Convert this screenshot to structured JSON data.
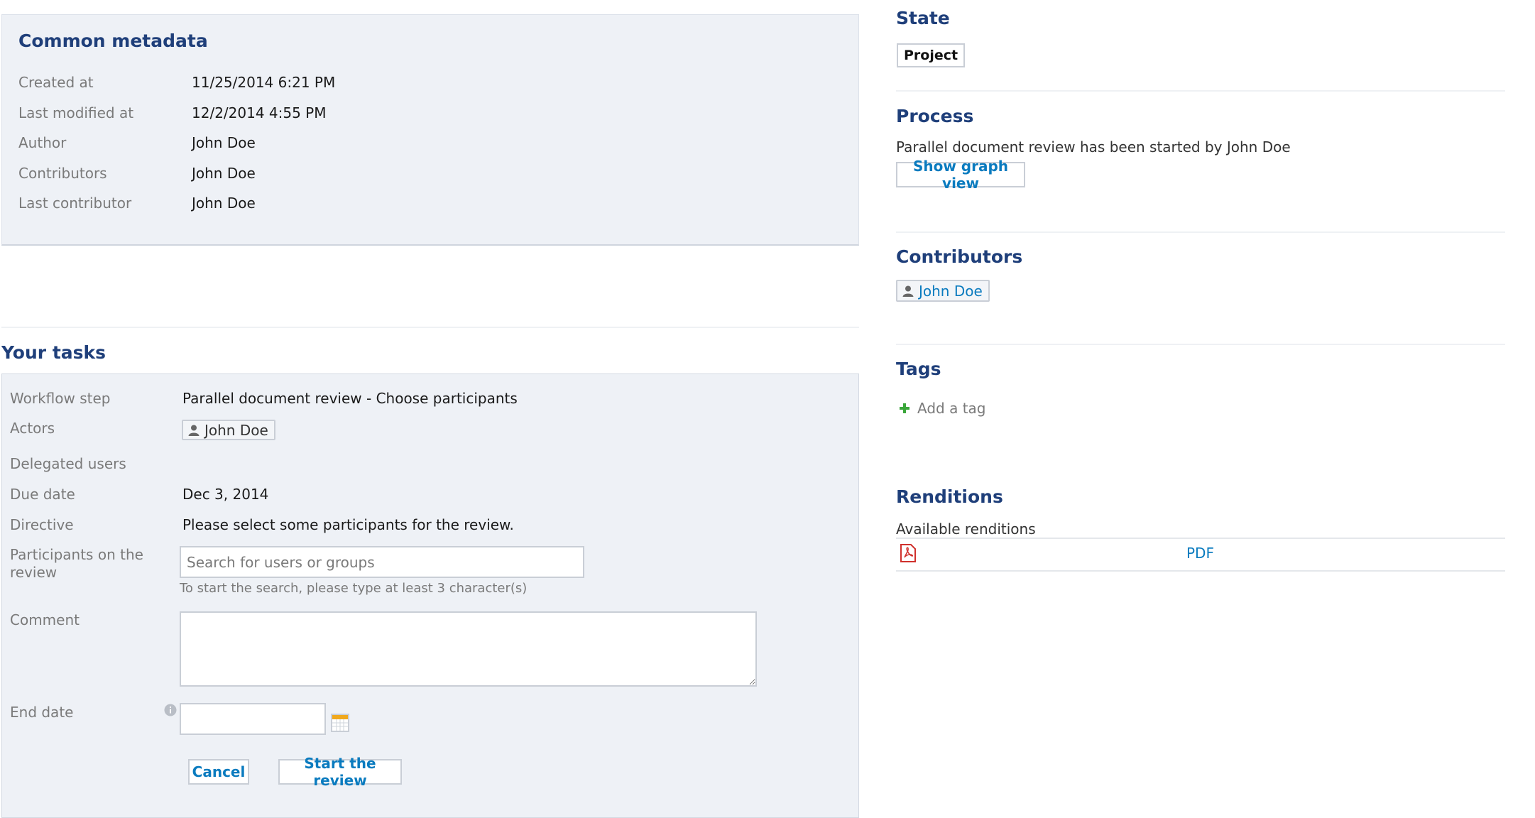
{
  "common_metadata": {
    "title": "Common metadata",
    "rows": [
      {
        "label": "Created at",
        "value": "11/25/2014 6:21 PM"
      },
      {
        "label": "Last modified at",
        "value": "12/2/2014 4:55 PM"
      },
      {
        "label": "Author",
        "value": "John Doe"
      },
      {
        "label": "Contributors",
        "value": "John Doe"
      },
      {
        "label": "Last contributor",
        "value": "John Doe"
      }
    ]
  },
  "tasks": {
    "title": "Your tasks",
    "workflow_step_label": "Workflow step",
    "workflow_step_value": "Parallel document review - Choose participants",
    "actors_label": "Actors",
    "actors_value": "John Doe",
    "delegated_label": "Delegated users",
    "due_date_label": "Due date",
    "due_date_value": "Dec 3, 2014",
    "directive_label": "Directive",
    "directive_value": "Please select some participants for the review.",
    "participants_label": "Participants on the review",
    "participants_placeholder": "Search for users or groups",
    "participants_hint": "To start the search, please type at least 3 character(s)",
    "comment_label": "Comment",
    "comment_value": "",
    "end_date_label": "End date",
    "end_date_value": "",
    "cancel_label": "Cancel",
    "start_label": "Start the review"
  },
  "sidebar": {
    "state_title": "State",
    "state_value": "Project",
    "process_title": "Process",
    "process_text": "Parallel document review has been started by John Doe",
    "graph_button": "Show graph view",
    "contributors_title": "Contributors",
    "contributor_name": "John Doe",
    "tags_title": "Tags",
    "add_tag_label": "Add a tag",
    "renditions_title": "Renditions",
    "available_label": "Available renditions",
    "rendition_name": "PDF"
  },
  "colors": {
    "heading": "#1f3f7a",
    "link": "#0a7bbf",
    "panel_bg": "#eef1f6",
    "add_icon": "#3aa63a",
    "pdf_icon": "#d0312d"
  },
  "icons": [
    "person-icon",
    "info-icon",
    "calendar-icon",
    "plus-icon",
    "pdf-icon",
    "resize-handle-icon"
  ]
}
